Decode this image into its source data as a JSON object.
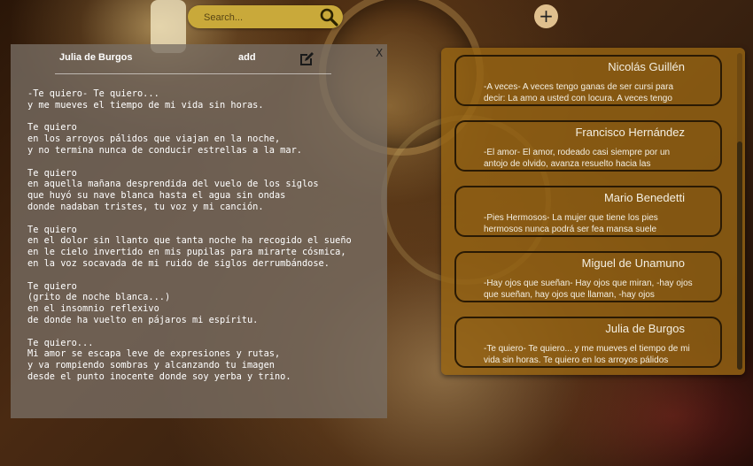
{
  "search": {
    "placeholder": "Search..."
  },
  "toolbar": {
    "add_symbol": "+"
  },
  "editor": {
    "close_label": "X",
    "author": "Julia de Burgos",
    "add_label": "add",
    "poem": "-Te quiero- Te quiero...\ny me mueves el tiempo de mi vida sin horas.\n\nTe quiero\nen los arroyos pálidos que viajan en la noche,\ny no termina nunca de conducir estrellas a la mar.\n\nTe quiero\nen aquella mañana desprendida del vuelo de los siglos\nque huyó su nave blanca hasta el agua sin ondas\ndonde nadaban tristes, tu voz y mi canción.\n\nTe quiero\nen el dolor sin llanto que tanta noche ha recogido el sueño\nen le cielo invertido en mis pupilas para mirarte cósmica,\nen la voz socavada de mi ruido de siglos derrumbándose.\n\nTe quiero\n(grito de noche blanca...)\nen el insomnio reflexivo\nde donde ha vuelto en pájaros mi espíritu.\n\nTe quiero...\nMi amor se escapa leve de expresiones y rutas,\ny va rompiendo sombras y alcanzando tu imagen\ndesde el punto inocente donde soy yerba y trino."
  },
  "cards": [
    {
      "author": "Nicolás Guillén",
      "excerpt": "-A veces- A veces tengo ganas de ser cursi para decir: La amo a usted con locura. A veces tengo"
    },
    {
      "author": "Francisco Hernández",
      "excerpt": "-El amor- El amor, rodeado casi siempre por un antojo de olvido, avanza resuelto hacia las"
    },
    {
      "author": "Mario Benedetti",
      "excerpt": "-Pies Hermosos- La mujer que tiene los pies hermosos nunca podrá ser fea mansa suele"
    },
    {
      "author": "Miguel de Unamuno",
      "excerpt": "-Hay ojos que sueñan- Hay ojos que miran, -hay ojos que sueñan, hay ojos que llaman, -hay ojos"
    },
    {
      "author": "Julia de Burgos",
      "excerpt": "-Te quiero- Te quiero... y me mueves el tiempo de mi vida sin horas. Te quiero en los arroyos pálidos"
    }
  ],
  "colors": {
    "search_bg": "#c9a93a",
    "add_button": "#e0c08e",
    "panel": "#966414",
    "card_border": "#2a1a04"
  }
}
